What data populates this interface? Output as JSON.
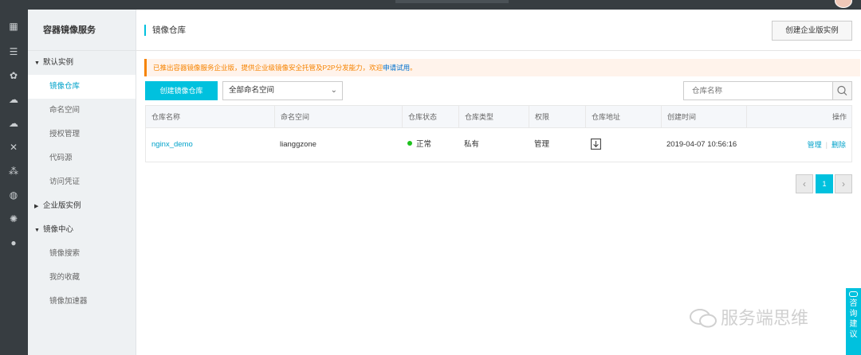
{
  "sidebar": {
    "title": "容器镜像服务",
    "groups": [
      {
        "label": "默认实例",
        "expanded": true,
        "items": [
          {
            "label": "镜像仓库",
            "active": true
          },
          {
            "label": "命名空间"
          },
          {
            "label": "授权管理"
          },
          {
            "label": "代码源"
          },
          {
            "label": "访问凭证"
          }
        ]
      },
      {
        "label": "企业版实例",
        "expanded": false,
        "items": []
      },
      {
        "label": "镜像中心",
        "expanded": true,
        "items": [
          {
            "label": "镜像搜索"
          },
          {
            "label": "我的收藏"
          },
          {
            "label": "镜像加速器"
          }
        ]
      }
    ]
  },
  "header": {
    "title": "镜像仓库",
    "enterprise_button": "创建企业版实例"
  },
  "notice": {
    "text": "已推出容器镜像服务企业版，提供企业级镜像安全托管及P2P分发能力，欢迎",
    "link": "申请试用",
    "suffix": "。"
  },
  "toolbar": {
    "create_button": "创建镜像仓库",
    "namespace_selected": "全部命名空间",
    "search_placeholder": "仓库名称"
  },
  "table": {
    "columns": [
      "仓库名称",
      "命名空间",
      "仓库状态",
      "仓库类型",
      "权限",
      "仓库地址",
      "创建时间",
      "操作"
    ],
    "rows": [
      {
        "name": "nginx_demo",
        "namespace": "lianggzone",
        "status": "正常",
        "type": "私有",
        "permission": "管理",
        "created": "2019-04-07 10:56:16",
        "actions": [
          "管理",
          "删除"
        ]
      }
    ]
  },
  "pagination": {
    "prev": "‹",
    "current": "1",
    "next": "›"
  },
  "consult": {
    "line1": "咨询",
    "line2": "建议"
  },
  "watermark": "服务端思维",
  "colors": {
    "accent": "#00c1de",
    "link": "#00a2ca",
    "notice": "#f68300",
    "status_ok": "#1dc11d"
  }
}
